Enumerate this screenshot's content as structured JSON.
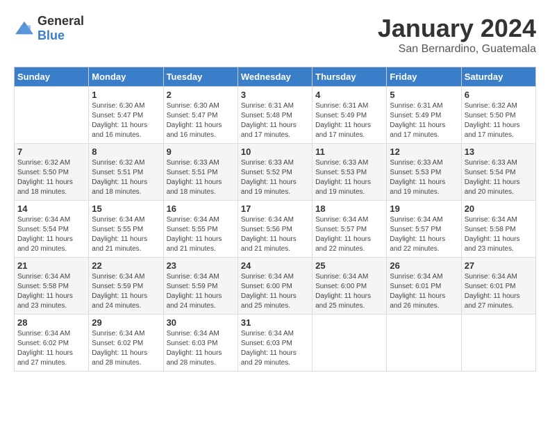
{
  "header": {
    "logo_general": "General",
    "logo_blue": "Blue",
    "title": "January 2024",
    "subtitle": "San Bernardino, Guatemala"
  },
  "days_of_week": [
    "Sunday",
    "Monday",
    "Tuesday",
    "Wednesday",
    "Thursday",
    "Friday",
    "Saturday"
  ],
  "weeks": [
    [
      {
        "day": "",
        "info": ""
      },
      {
        "day": "1",
        "info": "Sunrise: 6:30 AM\nSunset: 5:47 PM\nDaylight: 11 hours\nand 16 minutes."
      },
      {
        "day": "2",
        "info": "Sunrise: 6:30 AM\nSunset: 5:47 PM\nDaylight: 11 hours\nand 16 minutes."
      },
      {
        "day": "3",
        "info": "Sunrise: 6:31 AM\nSunset: 5:48 PM\nDaylight: 11 hours\nand 17 minutes."
      },
      {
        "day": "4",
        "info": "Sunrise: 6:31 AM\nSunset: 5:49 PM\nDaylight: 11 hours\nand 17 minutes."
      },
      {
        "day": "5",
        "info": "Sunrise: 6:31 AM\nSunset: 5:49 PM\nDaylight: 11 hours\nand 17 minutes."
      },
      {
        "day": "6",
        "info": "Sunrise: 6:32 AM\nSunset: 5:50 PM\nDaylight: 11 hours\nand 17 minutes."
      }
    ],
    [
      {
        "day": "7",
        "info": "Sunrise: 6:32 AM\nSunset: 5:50 PM\nDaylight: 11 hours\nand 18 minutes."
      },
      {
        "day": "8",
        "info": "Sunrise: 6:32 AM\nSunset: 5:51 PM\nDaylight: 11 hours\nand 18 minutes."
      },
      {
        "day": "9",
        "info": "Sunrise: 6:33 AM\nSunset: 5:51 PM\nDaylight: 11 hours\nand 18 minutes."
      },
      {
        "day": "10",
        "info": "Sunrise: 6:33 AM\nSunset: 5:52 PM\nDaylight: 11 hours\nand 19 minutes."
      },
      {
        "day": "11",
        "info": "Sunrise: 6:33 AM\nSunset: 5:53 PM\nDaylight: 11 hours\nand 19 minutes."
      },
      {
        "day": "12",
        "info": "Sunrise: 6:33 AM\nSunset: 5:53 PM\nDaylight: 11 hours\nand 19 minutes."
      },
      {
        "day": "13",
        "info": "Sunrise: 6:33 AM\nSunset: 5:54 PM\nDaylight: 11 hours\nand 20 minutes."
      }
    ],
    [
      {
        "day": "14",
        "info": "Sunrise: 6:34 AM\nSunset: 5:54 PM\nDaylight: 11 hours\nand 20 minutes."
      },
      {
        "day": "15",
        "info": "Sunrise: 6:34 AM\nSunset: 5:55 PM\nDaylight: 11 hours\nand 21 minutes."
      },
      {
        "day": "16",
        "info": "Sunrise: 6:34 AM\nSunset: 5:55 PM\nDaylight: 11 hours\nand 21 minutes."
      },
      {
        "day": "17",
        "info": "Sunrise: 6:34 AM\nSunset: 5:56 PM\nDaylight: 11 hours\nand 21 minutes."
      },
      {
        "day": "18",
        "info": "Sunrise: 6:34 AM\nSunset: 5:57 PM\nDaylight: 11 hours\nand 22 minutes."
      },
      {
        "day": "19",
        "info": "Sunrise: 6:34 AM\nSunset: 5:57 PM\nDaylight: 11 hours\nand 22 minutes."
      },
      {
        "day": "20",
        "info": "Sunrise: 6:34 AM\nSunset: 5:58 PM\nDaylight: 11 hours\nand 23 minutes."
      }
    ],
    [
      {
        "day": "21",
        "info": "Sunrise: 6:34 AM\nSunset: 5:58 PM\nDaylight: 11 hours\nand 23 minutes."
      },
      {
        "day": "22",
        "info": "Sunrise: 6:34 AM\nSunset: 5:59 PM\nDaylight: 11 hours\nand 24 minutes."
      },
      {
        "day": "23",
        "info": "Sunrise: 6:34 AM\nSunset: 5:59 PM\nDaylight: 11 hours\nand 24 minutes."
      },
      {
        "day": "24",
        "info": "Sunrise: 6:34 AM\nSunset: 6:00 PM\nDaylight: 11 hours\nand 25 minutes."
      },
      {
        "day": "25",
        "info": "Sunrise: 6:34 AM\nSunset: 6:00 PM\nDaylight: 11 hours\nand 25 minutes."
      },
      {
        "day": "26",
        "info": "Sunrise: 6:34 AM\nSunset: 6:01 PM\nDaylight: 11 hours\nand 26 minutes."
      },
      {
        "day": "27",
        "info": "Sunrise: 6:34 AM\nSunset: 6:01 PM\nDaylight: 11 hours\nand 27 minutes."
      }
    ],
    [
      {
        "day": "28",
        "info": "Sunrise: 6:34 AM\nSunset: 6:02 PM\nDaylight: 11 hours\nand 27 minutes."
      },
      {
        "day": "29",
        "info": "Sunrise: 6:34 AM\nSunset: 6:02 PM\nDaylight: 11 hours\nand 28 minutes."
      },
      {
        "day": "30",
        "info": "Sunrise: 6:34 AM\nSunset: 6:03 PM\nDaylight: 11 hours\nand 28 minutes."
      },
      {
        "day": "31",
        "info": "Sunrise: 6:34 AM\nSunset: 6:03 PM\nDaylight: 11 hours\nand 29 minutes."
      },
      {
        "day": "",
        "info": ""
      },
      {
        "day": "",
        "info": ""
      },
      {
        "day": "",
        "info": ""
      }
    ]
  ]
}
